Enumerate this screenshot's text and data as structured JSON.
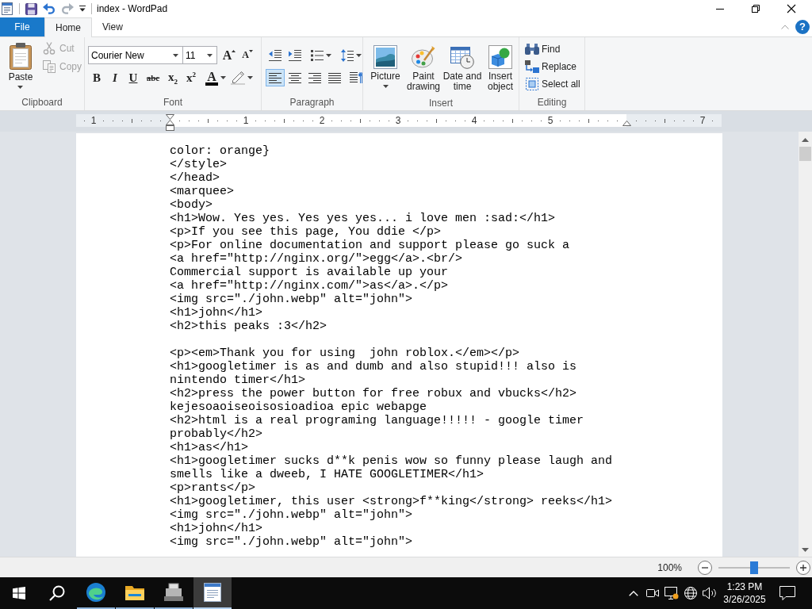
{
  "window": {
    "title": "index - WordPad"
  },
  "tabs": [
    {
      "label": "File",
      "kind": "menu",
      "selected": false
    },
    {
      "label": "Home",
      "kind": "tab",
      "selected": true
    },
    {
      "label": "View",
      "kind": "tab",
      "selected": false
    }
  ],
  "help_button": {
    "label": "?"
  },
  "clipboard": {
    "label": "Clipboard",
    "buttons": [
      {
        "kind": "paste",
        "label": "Paste",
        "disabled": false
      },
      {
        "kind": "cut",
        "label": "Cut",
        "disabled": true
      },
      {
        "kind": "copy",
        "label": "Copy",
        "disabled": true
      }
    ]
  },
  "font": {
    "label": "Font",
    "font_name": "Courier New",
    "font_size": "11",
    "size_buttons": [
      {
        "kind": "grow",
        "glyph": "A"
      },
      {
        "kind": "shrink",
        "glyph": "A"
      }
    ],
    "format_buttons": [
      {
        "kind": "bold",
        "glyph": "B"
      },
      {
        "kind": "italic",
        "glyph": "I"
      },
      {
        "kind": "underline",
        "glyph": "U"
      },
      {
        "kind": "strikethrough",
        "glyph": "abc"
      },
      {
        "kind": "subscript",
        "glyph": "x$_{2}$"
      },
      {
        "kind": "superscript",
        "glyph": "x$^{2}$"
      },
      {
        "kind": "text-color",
        "glyph": "A"
      },
      {
        "kind": "highlight"
      }
    ]
  },
  "paragraph": {
    "label": "Paragraph",
    "alignments": [
      {
        "kind": "left",
        "selected": true
      },
      {
        "kind": "center",
        "selected": false
      },
      {
        "kind": "right",
        "selected": false
      },
      {
        "kind": "justify",
        "selected": false
      }
    ]
  },
  "insert": {
    "label": "Insert",
    "buttons": [
      {
        "kind": "picture",
        "label": "Picture"
      },
      {
        "kind": "paint",
        "label": "Paint drawing"
      },
      {
        "kind": "date-time",
        "label": "Date and time"
      },
      {
        "kind": "object",
        "label": "Insert object"
      }
    ]
  },
  "editing": {
    "label": "Editing",
    "buttons": [
      {
        "kind": "find",
        "label": "Find"
      },
      {
        "kind": "replace",
        "label": "Replace"
      },
      {
        "kind": "select-all",
        "label": "Select all"
      }
    ]
  },
  "ruler": {
    "marks": [
      {
        "kind": "number",
        "text": "1"
      },
      {
        "kind": "left-indent"
      },
      {
        "kind": "number",
        "text": "1"
      },
      {
        "kind": "number",
        "text": "2"
      },
      {
        "kind": "number",
        "text": "3"
      },
      {
        "kind": "number",
        "text": "4"
      },
      {
        "kind": "number",
        "text": "5"
      },
      {
        "kind": "right-indent"
      },
      {
        "kind": "number",
        "text": "7"
      }
    ]
  },
  "document": {
    "blocks": [
      {
        "lines": [
          "color: orange}",
          "</style>",
          "</head>",
          "<marquee>",
          "<body>",
          "<h1>Wow. Yes yes. Yes yes yes... i love men :sad:</h1>",
          "<p>If you see this page, You ddie </p>",
          "<p>For online documentation and support please go suck a",
          "<a href=\"http://nginx.org/\">egg</a>.<br/>",
          "Commercial support is available up your",
          "<a href=\"http://nginx.com/\">as</a>.</p>",
          "<img src=\"./john.webp\" alt=\"john\">",
          "<h1>john</h1>",
          "<h2>this peaks :3</h2>"
        ]
      },
      {
        "lines": [
          "<p><em>Thank you for using  john roblox.</em></p>",
          "<h1>googletimer is as and dumb and also stupid!!! also is nintendo timer</h1>",
          "<h2>press the power button for free robux and vbucks</h2>",
          "kejesoaoiseoisosioadioa epic webapge",
          "<h2>html is a real programing language!!!!! - google timer probably</h2>",
          "<h1>as</h1>",
          "<h1>googletimer sucks d**k penis wow so funny please laugh and smells like a dweeb, I HATE GOOGLETIMER</h1>",
          "<p>rants</p>",
          "<h1>googletimer, this user <strong>f**king</strong> reeks</h1>",
          "<img src=\"./john.webp\" alt=\"john\">",
          "<h1>john</h1>",
          "<img src=\"./john.webp\" alt=\"john\">"
        ]
      }
    ]
  },
  "status_bar": {
    "zoom": "100%",
    "zoom_slider": {
      "level": 0.5
    }
  },
  "taskbar": {
    "apps": [
      {
        "kind": "browser",
        "selected": false
      },
      {
        "kind": "folder",
        "selected": false
      },
      {
        "kind": "device",
        "selected": false
      },
      {
        "kind": "document",
        "selected": true
      }
    ],
    "time": "1:23 PM",
    "date": "3/26/2025"
  }
}
